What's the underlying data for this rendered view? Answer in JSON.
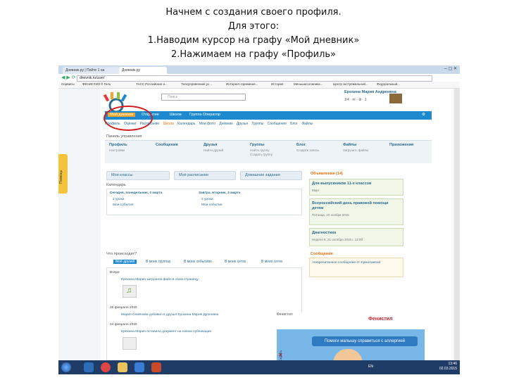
{
  "instructions": [
    "Начнем с создания своего профиля.",
    "Для этого:",
    "1.Наводим курсор на графу «Мой дневник»",
    "2.Нажимаем на графу «Профиль»"
  ],
  "browser": {
    "tabs": [
      "Дневник.ру | Пойте 1 на",
      "Дневник.ру"
    ],
    "address": "dnevnik.ru/user/",
    "bookmarks": [
      "Сервисы",
      "ФЕНИСТИЛ ® Гель",
      "ТАСС Российские н...",
      "Телеуправление ус...",
      "Интернет-приемная...",
      "История",
      "Меньшая клиника...",
      "Центр экстремальной...",
      "Федеральный..."
    ]
  },
  "site": {
    "search_placeholder": "Поиск",
    "user_name": "Ерохина Мария Андреевна",
    "user_links": "1/4  ·  ✉  ·  ⚙  ·  1",
    "main_nav": [
      "Мой дневник",
      "Открытие",
      "Школа",
      "Группа Оператор"
    ],
    "sub_nav": [
      "Профиль",
      "Оценки",
      "Расписание",
      "Школа",
      "Календарь",
      "Мои фото",
      "Дневник",
      "Друзья",
      "Группы",
      "Сообщения",
      "Блог",
      "Файлы"
    ],
    "control_panel_title": "Панель управления",
    "panel": [
      {
        "title": "Профиль",
        "sub": "Настройки"
      },
      {
        "title": "Сообщения",
        "sub": ""
      },
      {
        "title": "Друзья",
        "sub": "Найти друзей"
      },
      {
        "title": "Группы",
        "sub": "Найти группу\nСоздать группу"
      },
      {
        "title": "Блог",
        "sub": "Создать запись"
      },
      {
        "title": "Файлы",
        "sub": "Загрузить файлы"
      },
      {
        "title": "Приложения",
        "sub": ""
      }
    ],
    "quick_buttons": [
      "Мои классы",
      "Моё расписание",
      "Домашние задания"
    ],
    "calendar_title": "Календарь",
    "today": "Сегодня, понедельник, 2 марта",
    "today_items": [
      "2 уроки",
      "Мои события"
    ],
    "tomorrow": "Завтра, вторник, 3 марта",
    "tomorrow_items": [
      "2 уроки",
      "Мои события"
    ],
    "news_title": "Объявления (14)",
    "cards": [
      {
        "title": "Для выпускников 11-х классов",
        "sub": "Март"
      },
      {
        "title": "Всероссийский день правовой помощи детям",
        "sub": "Пятница, 20 ноября 2015"
      },
      {
        "title": "Диагностика",
        "sub": "Неделя 8, 21 октября 2015 г. 12:00"
      }
    ],
    "messages_title": "Сообщения",
    "messages_item": "Непрочитанное сообщение от Ермолаевой",
    "whats_new": "Что происходит?",
    "feed_tabs": [
      "Моё друзей",
      "В моих группах",
      "В моих событиях",
      "В моих сетях",
      "В моих сетях"
    ],
    "feed_today": "Вчера",
    "feed_entry1": "Ерохина Мария загрузила файл в свою страницу",
    "feed_date1": "26 февраля 2015",
    "feed_entry2": "Мария Семёнова добавил в друзья Ерохина Мария Дроновна",
    "feed_date2": "24 февраля 2015",
    "feed_entry3": "Ерохина Мария оставила документ на новом публикации",
    "sidebar_tab": "Помощь"
  },
  "ad": {
    "label": "Фенистил",
    "brand": "Фенистил",
    "slogan": "Помоги малышу справиться с аллергией",
    "side": "Скрыть"
  },
  "taskbar": {
    "lang": "EN",
    "time": "13:46",
    "date": "02.03.2015"
  }
}
